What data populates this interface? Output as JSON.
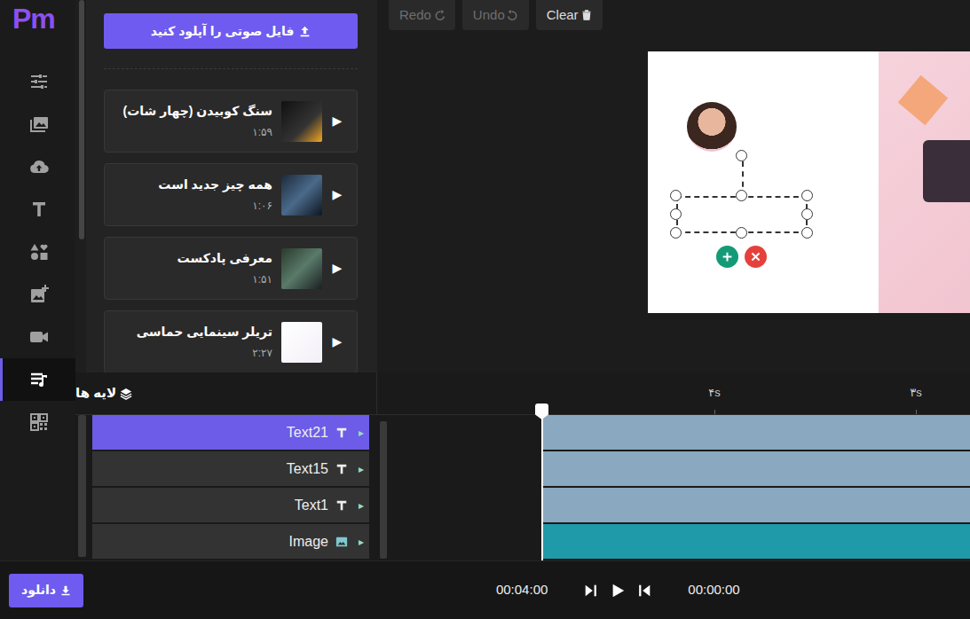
{
  "logo": "Pm",
  "sidebar": {
    "items": [
      {
        "selected": false
      },
      {
        "selected": false
      },
      {
        "selected": false
      },
      {
        "selected": false
      },
      {
        "selected": false
      },
      {
        "selected": false
      },
      {
        "selected": false
      },
      {
        "selected": true
      },
      {
        "selected": false
      }
    ]
  },
  "audio_panel": {
    "upload_button": "فایل صوتی را آپلود کنید",
    "tracks": [
      {
        "title": "سنگ کوبیدن (چهار شات)",
        "duration": "۱:۵۹",
        "play_icon": "▶"
      },
      {
        "title": "همه چیز جدید است",
        "duration": "۱:۰۶",
        "play_icon": "▶"
      },
      {
        "title": "معرفی پادکست",
        "duration": "۱:۵۱",
        "play_icon": "▶"
      },
      {
        "title": "تریلر سینمایی حماسی",
        "duration": "۲:۲۷",
        "play_icon": "▶"
      }
    ]
  },
  "toolbar": {
    "buttons": [
      {
        "label": "Redo",
        "disabled": true
      },
      {
        "label": "Undo",
        "disabled": true
      },
      {
        "label": "Clear",
        "disabled": false
      }
    ]
  },
  "canvas": {
    "text_box_selected": true
  },
  "layers": {
    "title": "لایه ها",
    "items": [
      {
        "name": "Text21",
        "kind": "text",
        "selected": true,
        "expand_icon": "▸",
        "color": "#8aa8bf"
      },
      {
        "name": "Text15",
        "kind": "text",
        "selected": false,
        "expand_icon": "▸",
        "color": "#8aa8bf"
      },
      {
        "name": "Text1",
        "kind": "text",
        "selected": false,
        "expand_icon": "▸",
        "color": "#8aa8bf"
      },
      {
        "name": "Image",
        "kind": "image",
        "selected": false,
        "expand_icon": "▸",
        "color": "#1f9aa8"
      }
    ]
  },
  "timeline": {
    "ticks": [
      "۴s",
      "۳s"
    ]
  },
  "transport": {
    "total": "00:04:00",
    "current": "00:00:00"
  },
  "download_button": "دانلود"
}
